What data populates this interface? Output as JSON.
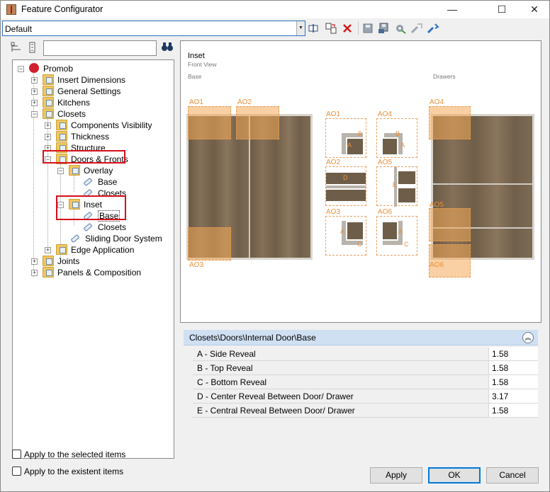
{
  "window": {
    "title": "Feature Configurator",
    "controls": {
      "minimize": "—",
      "maximize": "☐",
      "close": "✕"
    }
  },
  "toolbar": {
    "profile_value": "Default",
    "icons": [
      "rename-icon",
      "copy-icon",
      "delete-icon",
      "save-icon",
      "save-as-icon",
      "settings-icon",
      "export-icon",
      "import-icon"
    ]
  },
  "tree": {
    "items": [
      {
        "label": "Promob"
      },
      {
        "label": "Insert Dimensions"
      },
      {
        "label": "General Settings"
      },
      {
        "label": "Kitchens"
      },
      {
        "label": "Closets"
      },
      {
        "label": "Components Visibility"
      },
      {
        "label": "Thickness"
      },
      {
        "label": "Structure"
      },
      {
        "label": "Doors & Fronts"
      },
      {
        "label": "Overlay"
      },
      {
        "label": "Base"
      },
      {
        "label": "Closets"
      },
      {
        "label": "Inset"
      },
      {
        "label": "Base"
      },
      {
        "label": "Closets"
      },
      {
        "label": "Sliding Door System"
      },
      {
        "label": "Edge Application"
      },
      {
        "label": "Joints"
      },
      {
        "label": "Panels & Composition"
      }
    ],
    "selected": "Base"
  },
  "preview": {
    "title": "Inset",
    "subtitle": "Front View",
    "base_label": "Base",
    "drawers_label": "Drawers",
    "ao": {
      "ao1": "AO1",
      "ao2": "AO2",
      "ao3": "AO3",
      "ao4": "AO4",
      "ao5": "AO5",
      "ao6": "AO6"
    },
    "detail_letters": {
      "a": "A",
      "b": "B",
      "c": "C",
      "d": "D",
      "e": "E"
    }
  },
  "properties": {
    "path": "Closets\\Doors\\Internal Door\\Base",
    "rows": [
      {
        "label": "A - Side Reveal",
        "value": "1.58"
      },
      {
        "label": "B - Top Reveal",
        "value": "1.58"
      },
      {
        "label": "C - Bottom Reveal",
        "value": "1.58"
      },
      {
        "label": "D - Center Reveal Between Door/ Drawer",
        "value": "3.17"
      },
      {
        "label": "E - Central Reveal Between Door/ Drawer",
        "value": "1.58"
      }
    ]
  },
  "options": {
    "apply_selected": "Apply to the selected items",
    "apply_existent": "Apply to the existent items"
  },
  "buttons": {
    "apply": "Apply",
    "ok": "OK",
    "cancel": "Cancel"
  },
  "colors": {
    "highlight": "#f4aa58",
    "accent": "#0078d7",
    "annotation_red": "#d6101b"
  }
}
